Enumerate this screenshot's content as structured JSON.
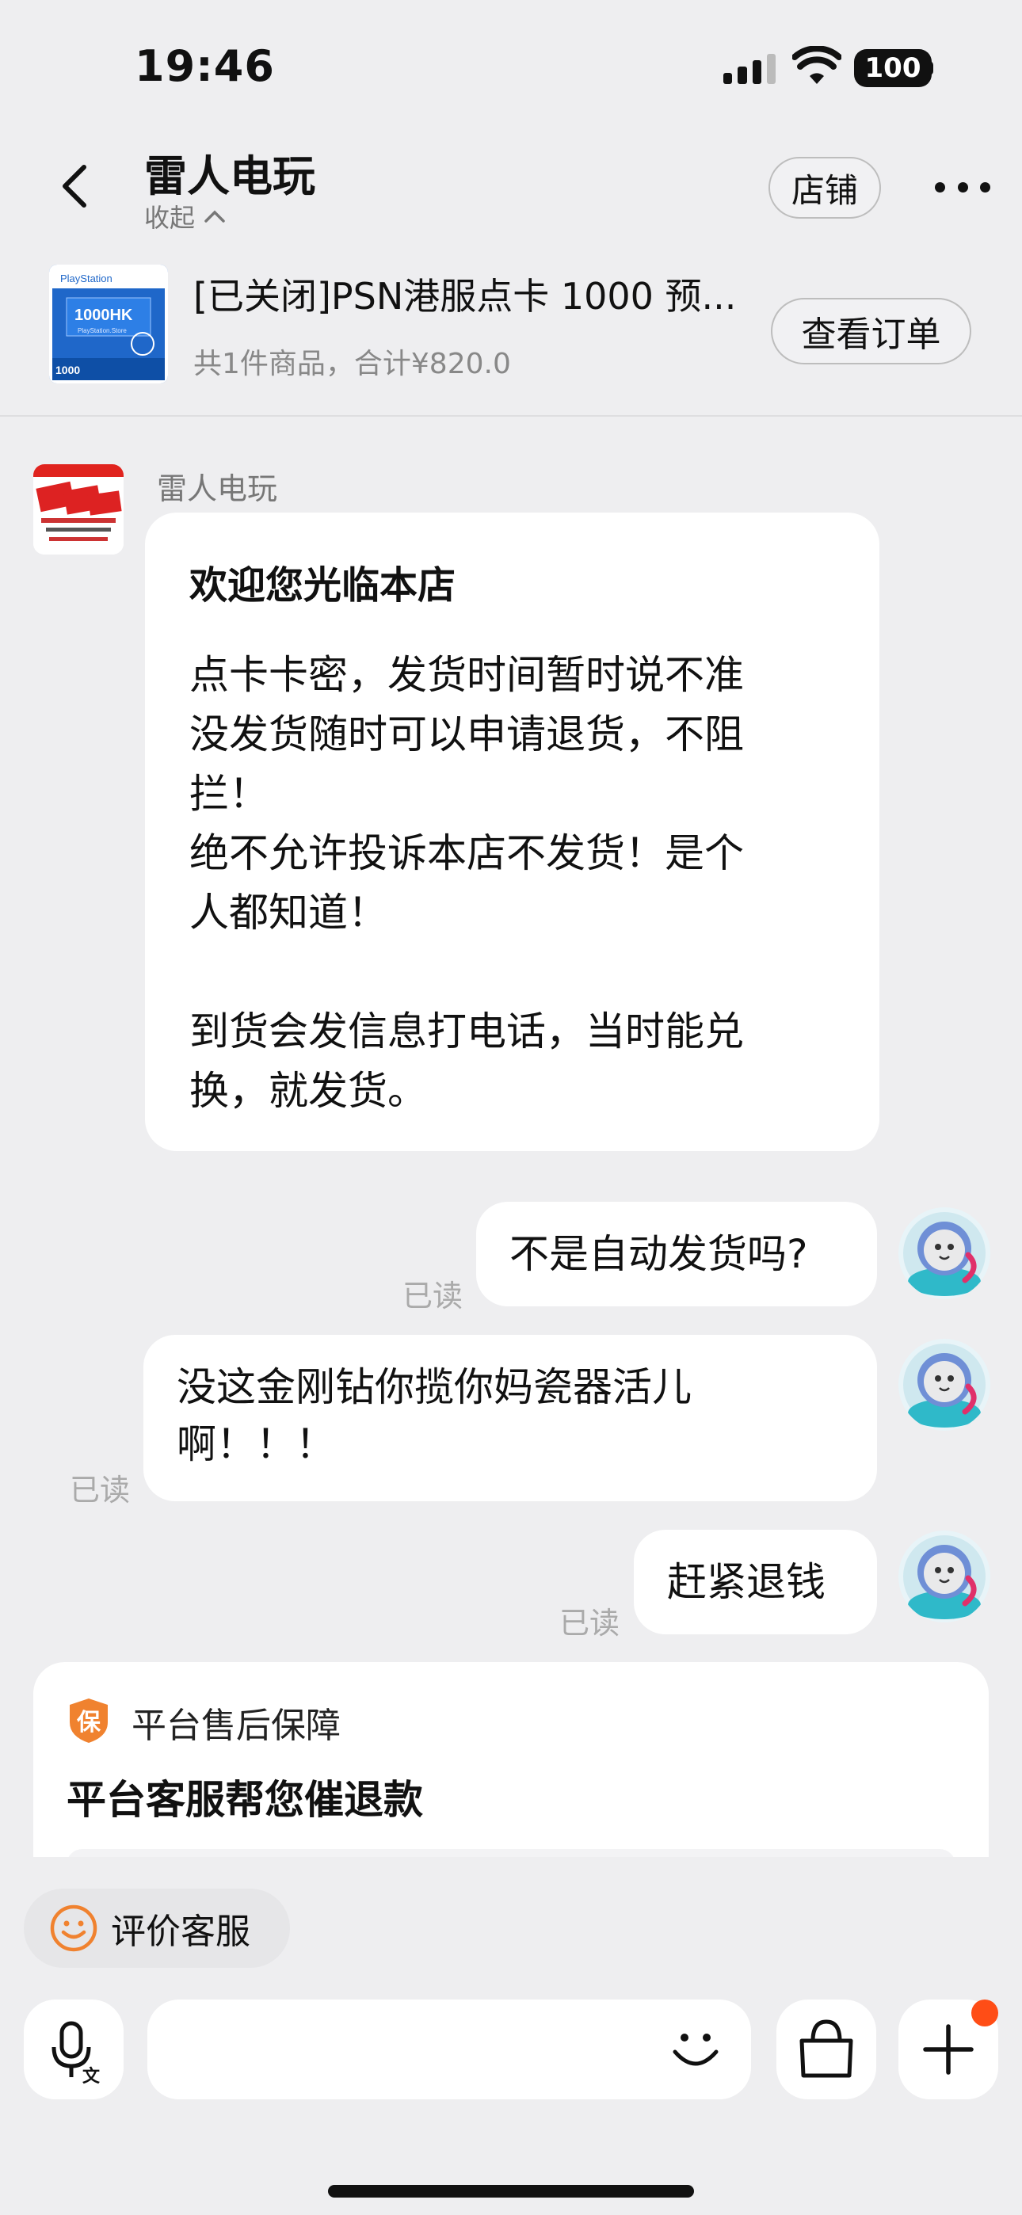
{
  "status_bar": {
    "time": "19:46",
    "battery": "100"
  },
  "header": {
    "shop_name": "雷人电玩",
    "collapse_label": "收起",
    "shop_button": "店铺"
  },
  "order": {
    "title": "[已关闭]PSN港服点卡 1000 预...",
    "summary": "共1件商品，合计¥820.0",
    "view_button": "查看订单",
    "thumb_text": {
      "brand": "PlayStation",
      "amount": "1000HK",
      "store": "PlayStation.Store",
      "corner": "1000"
    }
  },
  "messages": {
    "sender_name": "雷人电玩",
    "welcome_title": "欢迎您光临本店",
    "welcome_body": "点卡卡密，发货时间暂时说不准\n没发货随时可以申请退货，不阻\n拦！\n绝不允许投诉本店不发货！是个\n人都知道！\n\n到货会发信息打电话，当时能兑\n换，就发货。",
    "msg1": "不是自动发货吗?",
    "msg2": "没这金刚钻你揽你妈瓷器活儿\n啊！！！",
    "msg3": "赶紧退钱",
    "read": "已读"
  },
  "guarantee": {
    "badge": "保",
    "label": "平台售后保障",
    "title": "平台客服帮您催退款"
  },
  "rate_button": "评价客服",
  "colors": {
    "accent": "#f0822f",
    "notification": "#ff4d16"
  }
}
